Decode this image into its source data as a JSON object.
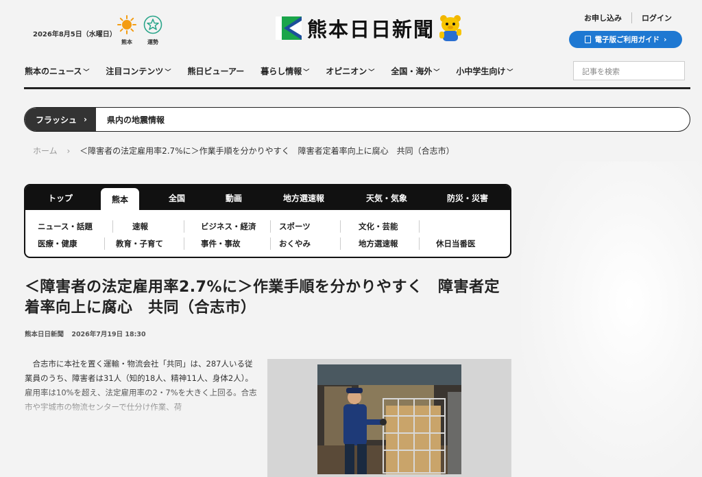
{
  "header": {
    "date": "2026年8月5日（水曜日）",
    "weather_label": "熊本",
    "fortune_label": "運勢",
    "logo_text": "熊本日日新聞",
    "links": [
      "お申し込み",
      "ログイン"
    ],
    "guide_button": "電子版ご利用ガイド",
    "search_placeholder": "記事を検索",
    "nav": [
      "熊本のニュース",
      "注目コンテンツ",
      "熊日ビューアー",
      "暮らし情報",
      "オピニオン",
      "全国・海外",
      "小中学生向け"
    ]
  },
  "flash": {
    "label": "フラッシュ",
    "text": "県内の地震情報"
  },
  "breadcrumb": {
    "home": "ホーム",
    "current": "＜障害者の法定雇用率2.7%に＞作業手順を分かりやすく　障害者定着率向上に腐心　共同（合志市）"
  },
  "category_tabs": [
    "トップ",
    "熊本",
    "全国",
    "動画",
    "地方選速報",
    "天気・気象",
    "防災・災害"
  ],
  "subcategories_row1": [
    "ニュース・話題",
    "速報",
    "ビジネス・経済",
    "スポーツ",
    "文化・芸能"
  ],
  "subcategories_row2": [
    "医療・健康",
    "教育・子育て",
    "事件・事故",
    "おくやみ",
    "地方選速報",
    "休日当番医"
  ],
  "article": {
    "headline": "＜障害者の法定雇用率2.7%に＞作業手順を分かりやすく　障害者定着率向上に腐心　共同（合志市）",
    "source": "熊本日日新聞",
    "timestamp": "2026年7月19日 18:30",
    "body": "合志市に本社を置く運輸・物流会社「共同」は、287人いる従業員のうち、障害者は31人（知的18人、精神11人、身体2人）。雇用率は10%を超え、法定雇用率の2・7%を大きく上回る。合志市や宇城市の物流センターで仕分け作業、荷"
  },
  "colors": {
    "accent_blue": "#1e78d2",
    "logo_green": "#1aa54a",
    "dark": "#111111"
  }
}
